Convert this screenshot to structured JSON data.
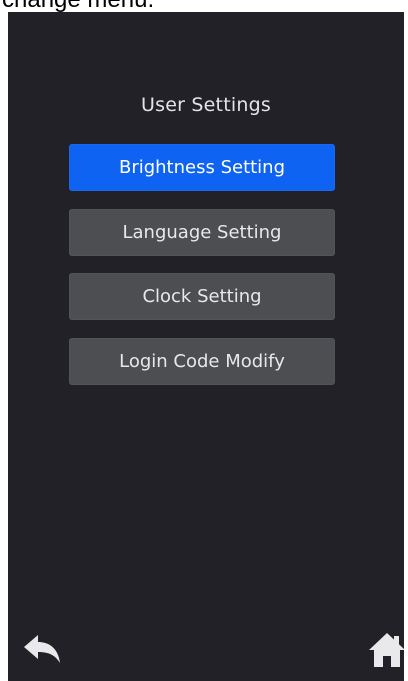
{
  "caption": "change menu.",
  "screen": {
    "title": "User Settings",
    "menu": [
      {
        "label": "Brightness Setting",
        "selected": true
      },
      {
        "label": "Language Setting",
        "selected": false
      },
      {
        "label": "Clock Setting",
        "selected": false
      },
      {
        "label": "Login Code Modify",
        "selected": false
      }
    ],
    "footer": {
      "back_icon": "back-arrow-icon",
      "home_icon": "home-icon"
    }
  },
  "colors": {
    "screen_bg": "#212127",
    "button_bg": "#4c4e51",
    "selected_bg": "#0f63f2",
    "text": "#e8e8ea"
  }
}
